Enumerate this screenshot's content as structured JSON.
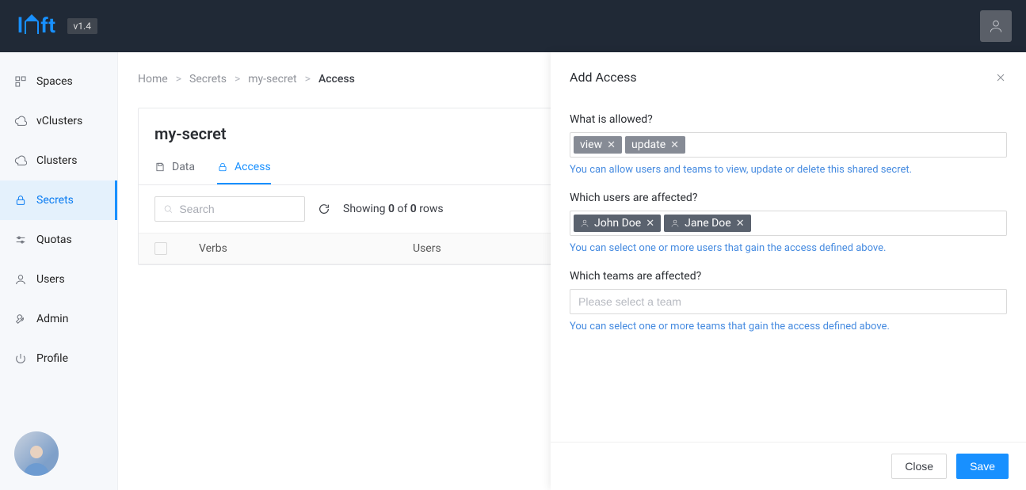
{
  "brand": {
    "name": "loft",
    "version": "v1.4"
  },
  "sidebar": {
    "items": [
      {
        "label": "Spaces"
      },
      {
        "label": "vClusters"
      },
      {
        "label": "Clusters"
      },
      {
        "label": "Secrets"
      },
      {
        "label": "Quotas"
      },
      {
        "label": "Users"
      },
      {
        "label": "Admin"
      },
      {
        "label": "Profile"
      }
    ],
    "activeIndex": 3
  },
  "breadcrumb": {
    "home": "Home",
    "secrets": "Secrets",
    "secret": "my-secret",
    "current": "Access"
  },
  "page": {
    "title": "my-secret",
    "tabs": {
      "data": "Data",
      "access": "Access"
    },
    "search_placeholder": "Search",
    "rows": {
      "prefix": "Showing ",
      "shown": "0",
      "mid": " of ",
      "total": "0",
      "suffix": " rows"
    },
    "columns": {
      "verbs": "Verbs",
      "users": "Users"
    }
  },
  "drawer": {
    "title": "Add Access",
    "allowed": {
      "label": "What is allowed?",
      "tags": [
        "view",
        "update"
      ],
      "help": "You can allow users and teams to view, update or delete this shared secret."
    },
    "users": {
      "label": "Which users are affected?",
      "tags": [
        "John Doe",
        "Jane Doe"
      ],
      "help": "You can select one or more users that gain the access defined above."
    },
    "teams": {
      "label": "Which teams are affected?",
      "placeholder": "Please select a team",
      "help": "You can select one or more teams that gain the access defined above."
    },
    "buttons": {
      "close": "Close",
      "save": "Save"
    }
  }
}
